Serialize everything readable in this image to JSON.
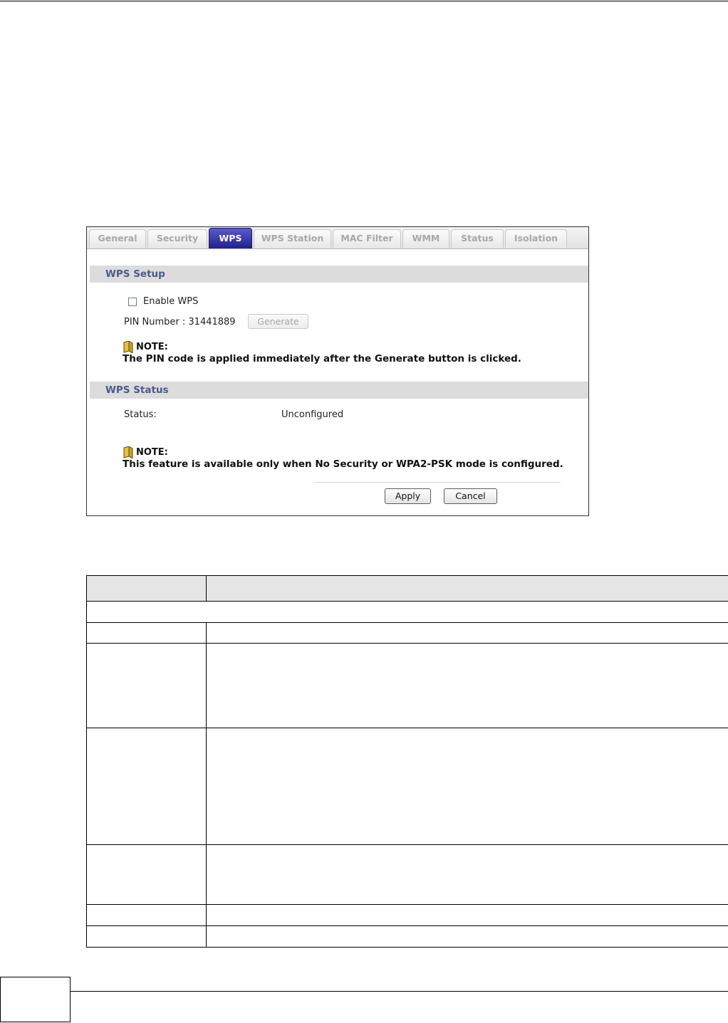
{
  "tabs": [
    "General",
    "Security",
    "WPS",
    "WPS Station",
    "MAC Filter",
    "WMM",
    "Status",
    "Isolation"
  ],
  "active_tab": "WPS",
  "wps_setup": {
    "title": "WPS Setup",
    "enable_label": "Enable WPS",
    "enable_checked": false,
    "pin_label": "PIN Number : 31441889",
    "generate_label": "Generate",
    "note_title": "NOTE:",
    "note_text": "The PIN code is applied immediately after the Generate button is clicked."
  },
  "wps_status": {
    "title": "WPS Status",
    "status_label": "Status:",
    "status_value": "Unconfigured",
    "note_title": "NOTE:",
    "note_text": "This feature is available only when No Security or WPA2-PSK mode is configured."
  },
  "buttons": {
    "apply": "Apply",
    "cancel": "Cancel"
  },
  "colors": {
    "active_tab": "#2a2a9a",
    "section_bar": "#dcdcdc",
    "section_title": "#4a5a8a"
  }
}
